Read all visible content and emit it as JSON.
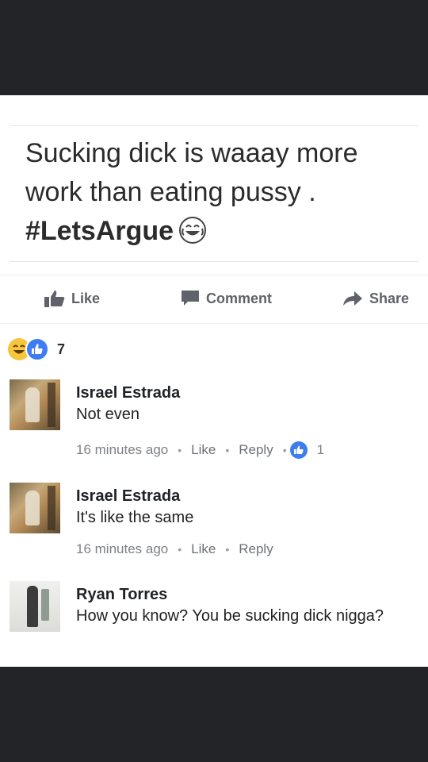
{
  "post": {
    "text_line1": "Sucking dick is waaay more",
    "text_line2": "work than eating pussy .",
    "hashtag": "#LetsArgue",
    "emoji": "laugh-emoji"
  },
  "actions": {
    "like": "Like",
    "comment": "Comment",
    "share": "Share"
  },
  "reactions": {
    "types": [
      "haha",
      "like"
    ],
    "count": "7"
  },
  "comments": [
    {
      "name": "Israel Estrada",
      "text": "Not even",
      "time": "16 minutes ago",
      "like": "Like",
      "reply": "Reply",
      "likes": "1"
    },
    {
      "name": "Israel Estrada",
      "text": "It's like the same",
      "time": "16 minutes ago",
      "like": "Like",
      "reply": "Reply"
    },
    {
      "name": "Ryan Torres",
      "text": "How you know? You be sucking dick nigga?"
    }
  ],
  "colors": {
    "background_dark": "#232427",
    "like_blue": "#3e7cf2",
    "haha_yellow": "#f7c53b"
  }
}
